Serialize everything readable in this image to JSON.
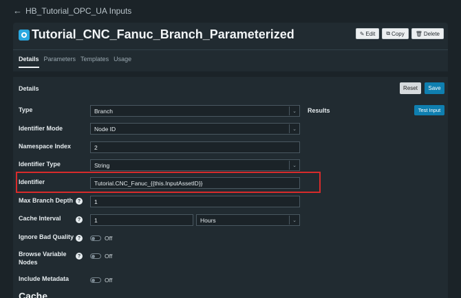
{
  "nav": {
    "back_label": "HB_Tutorial_OPC_UA Inputs"
  },
  "header": {
    "title": "Tutorial_CNC_Fanuc_Branch_Parameterized",
    "buttons": {
      "edit": "Edit",
      "copy": "Copy",
      "delete": "Delete"
    }
  },
  "tabs": [
    "Details",
    "Parameters",
    "Templates",
    "Usage"
  ],
  "panel": {
    "title": "Details",
    "reset_label": "Reset",
    "save_label": "Save",
    "results_label": "Results",
    "test_input_label": "Test Input",
    "cache_heading": "Cache"
  },
  "fields": {
    "type": {
      "label": "Type",
      "value": "Branch"
    },
    "identifier_mode": {
      "label": "Identifier Mode",
      "value": "Node ID"
    },
    "namespace_index": {
      "label": "Namespace Index",
      "value": "2"
    },
    "identifier_type": {
      "label": "Identifier Type",
      "value": "String"
    },
    "identifier": {
      "label": "Identifier",
      "value": "Tutorial.CNC_Fanuc_{{this.InputAssetID}}"
    },
    "max_branch_depth": {
      "label": "Max Branch Depth",
      "value": "1"
    },
    "cache_interval": {
      "label": "Cache Interval",
      "value": "1",
      "unit": "Hours"
    },
    "ignore_bad_quality": {
      "label": "Ignore Bad Quality",
      "state": "Off"
    },
    "browse_variable_nodes": {
      "label_line1": "Browse Variable",
      "label_line2": "Nodes",
      "state": "Off"
    },
    "include_metadata": {
      "label": "Include Metadata",
      "state": "Off"
    }
  },
  "colors": {
    "background": "#1b2328",
    "panel": "#212b31",
    "primary_button": "#0f7fb0",
    "highlight": "#d92b2b",
    "asset_icon": "#2aa8e0"
  }
}
